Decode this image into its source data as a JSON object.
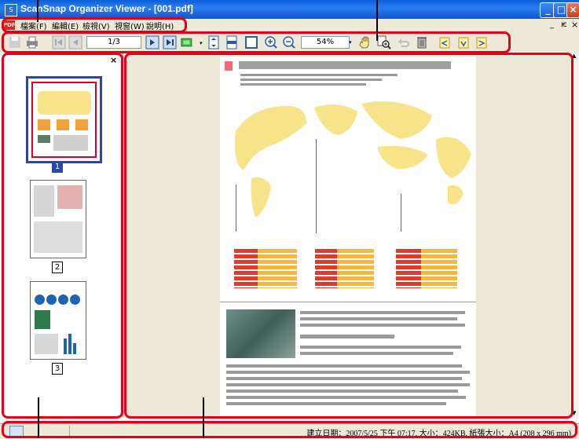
{
  "window": {
    "title": "ScanSnap Organizer Viewer - [001.pdf]",
    "app_icon": "scansnap-icon",
    "buttons": [
      "minimize",
      "maximize",
      "close"
    ],
    "mdi_buttons": [
      "_",
      "ѥ",
      "×"
    ]
  },
  "menu": {
    "icon_label": "PDF",
    "items": [
      {
        "label": "檔案(F)"
      },
      {
        "label": "編輯(E)"
      },
      {
        "label": "檢視(V)"
      },
      {
        "label": "視窗(W)"
      },
      {
        "label": "說明(H)"
      }
    ]
  },
  "toolbar": {
    "page_value": "1/3",
    "zoom_value": "54%"
  },
  "thumbnails": {
    "close_label": "×",
    "pages": [
      "1",
      "2",
      "3"
    ],
    "selected": "1"
  },
  "statusbar": {
    "text": "建立日期：2007/5/25 下午 07:17, 大小：424KB, 紙張大小：A4 (208 x 296 mm)"
  },
  "colors": {
    "highlight": "#e5001a",
    "titlebar": "#0a5fd8",
    "chrome": "#ece9d8",
    "map": "#f7e48a"
  }
}
